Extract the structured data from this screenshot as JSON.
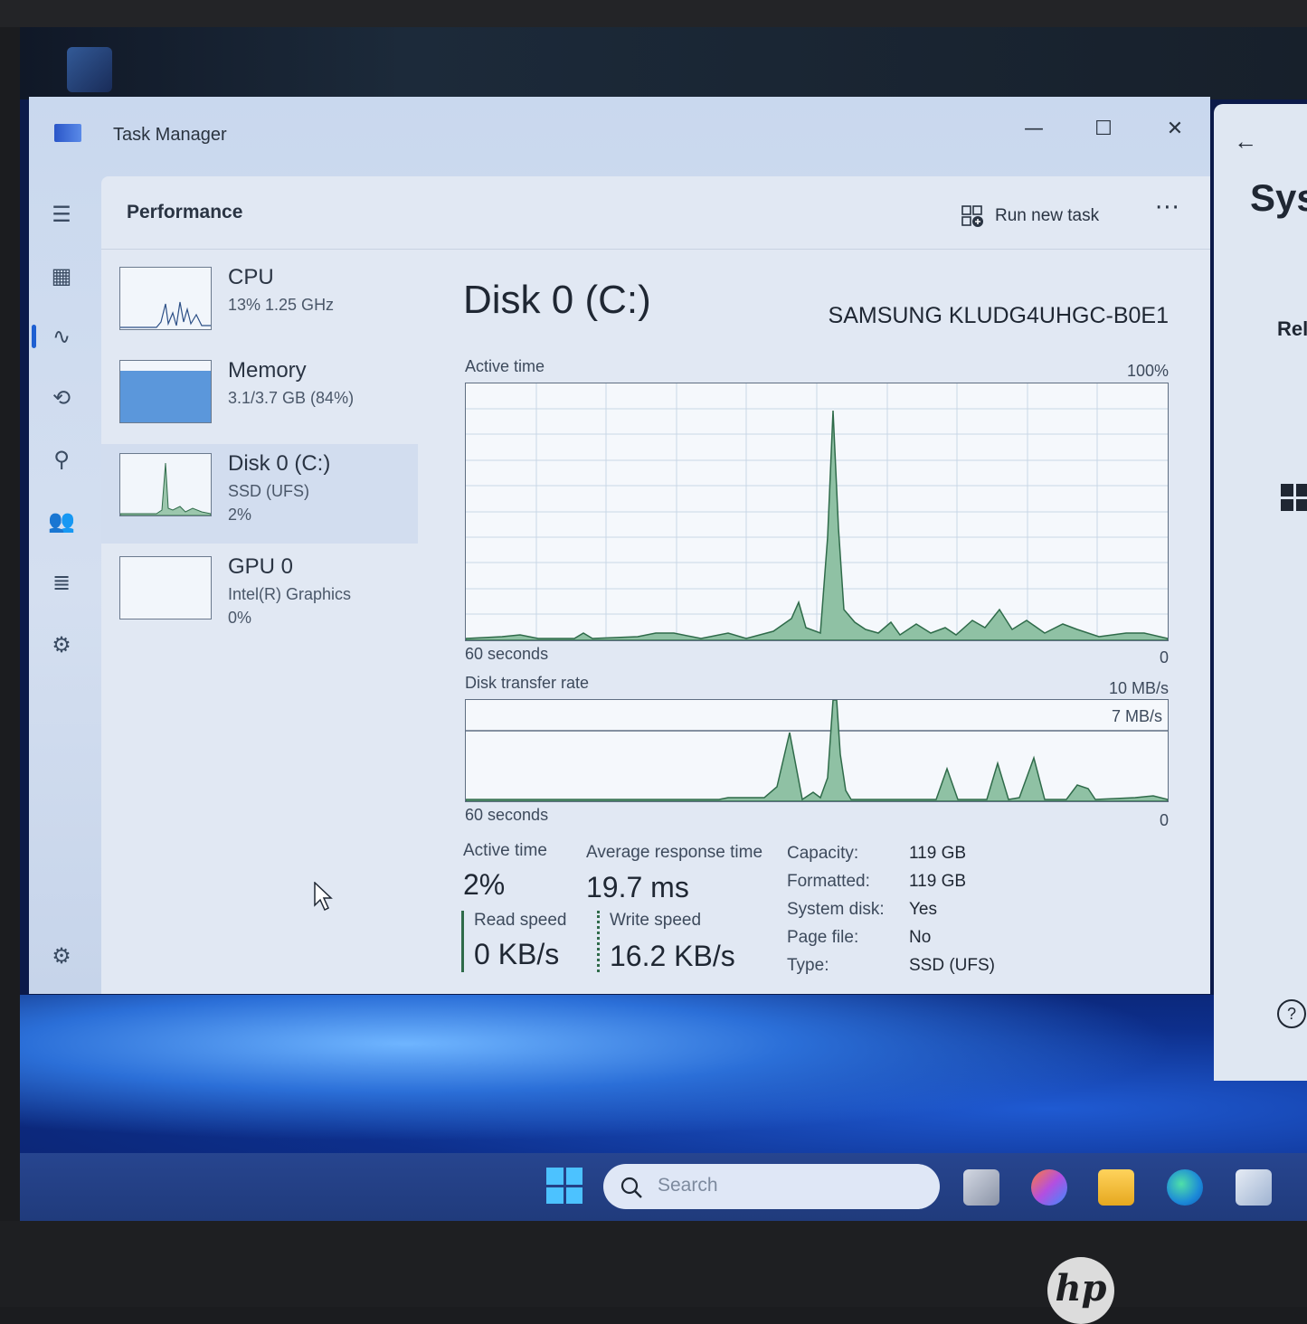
{
  "window": {
    "title": "Task Manager",
    "minimize_glyph": "—",
    "maximize_glyph": "☐",
    "close_glyph": "✕"
  },
  "header": {
    "page_title": "Performance",
    "run_new_task_label": "Run new task",
    "more_glyph": "···"
  },
  "nav": {
    "items": [
      {
        "icon": "hamburger-icon",
        "glyph": "☰"
      },
      {
        "icon": "processes-icon",
        "glyph": "▦"
      },
      {
        "icon": "performance-icon",
        "glyph": "∿",
        "active": true
      },
      {
        "icon": "app-history-icon",
        "glyph": "⟲"
      },
      {
        "icon": "startup-apps-icon",
        "glyph": "⚲"
      },
      {
        "icon": "users-icon",
        "glyph": "👥"
      },
      {
        "icon": "details-icon",
        "glyph": "≣"
      },
      {
        "icon": "services-icon",
        "glyph": "⚙"
      },
      {
        "icon": "settings-icon",
        "glyph": "⚙"
      }
    ]
  },
  "perf_list": [
    {
      "name": "CPU",
      "line1": "13%  1.25 GHz",
      "line2": ""
    },
    {
      "name": "Memory",
      "line1": "3.1/3.7 GB (84%)",
      "line2": ""
    },
    {
      "name": "Disk 0 (C:)",
      "line1": "SSD (UFS)",
      "line2": "2%"
    },
    {
      "name": "GPU 0",
      "line1": "Intel(R) Graphics",
      "line2": "0%"
    }
  ],
  "disk": {
    "title": "Disk 0 (C:)",
    "model": "SAMSUNG KLUDG4UHGC-B0E1",
    "active_graph": {
      "label": "Active time",
      "max_label": "100%",
      "time_label": "60 seconds",
      "min_label": "0"
    },
    "transfer_graph": {
      "label": "Disk transfer rate",
      "max_label": "10 MB/s",
      "mid_label": "7 MB/s",
      "time_label": "60 seconds",
      "min_label": "0"
    },
    "stats": {
      "active_time_label": "Active time",
      "active_time_value": "2%",
      "avg_response_label": "Average response time",
      "avg_response_value": "19.7 ms",
      "read_speed_label": "Read speed",
      "read_speed_value": "0 KB/s",
      "write_speed_label": "Write speed",
      "write_speed_value": "16.2 KB/s"
    },
    "properties": [
      {
        "key": "Capacity:",
        "value": "119 GB"
      },
      {
        "key": "Formatted:",
        "value": "119 GB"
      },
      {
        "key": "System disk:",
        "value": "Yes"
      },
      {
        "key": "Page file:",
        "value": "No"
      },
      {
        "key": "Type:",
        "value": "SSD (UFS)"
      }
    ]
  },
  "settings_peek": {
    "title_fragment": "Sys",
    "subtitle_fragment": "Rel",
    "back_glyph": "←",
    "help_glyph": "?"
  },
  "taskbar": {
    "search_placeholder": "Search"
  },
  "brand": {
    "laptop_logo": "hp"
  },
  "colors": {
    "graph_fill": "#6fa88a",
    "graph_line": "#2f6b4a",
    "memory_fill": "#5b97db",
    "accent": "#1e5fd1"
  }
}
